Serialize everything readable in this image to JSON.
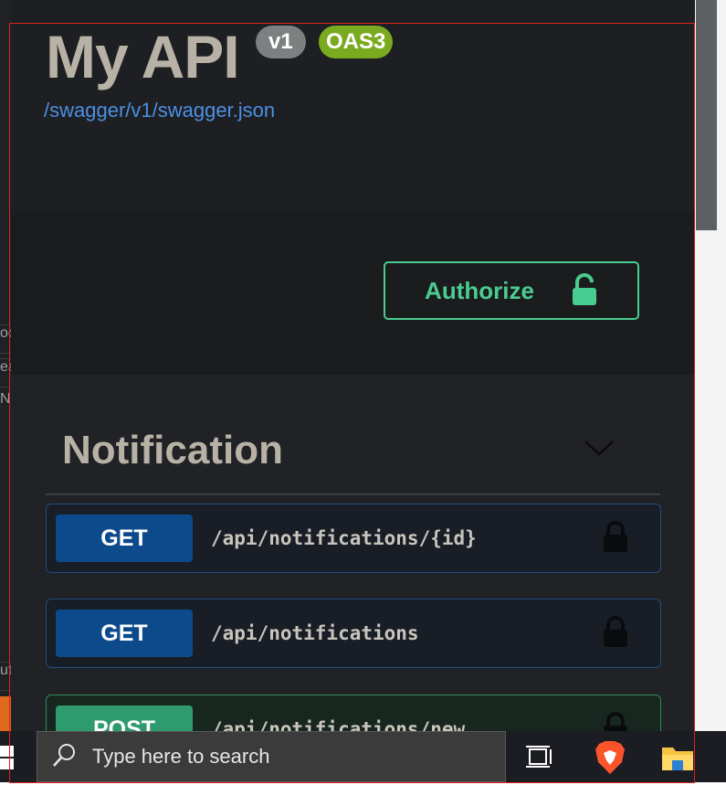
{
  "left_strip": {
    "fragments": [
      "oc",
      "ea",
      "N",
      "ut"
    ]
  },
  "api": {
    "title": "My API",
    "version": "v1",
    "oas": "OAS3",
    "spec_url": "/swagger/v1/swagger.json"
  },
  "authorize": {
    "label": "Authorize"
  },
  "tag": {
    "name": "Notification"
  },
  "operations": [
    {
      "method": "GET",
      "path": "/api/notifications/{id}"
    },
    {
      "method": "GET",
      "path": "/api/notifications"
    },
    {
      "method": "POST",
      "path": "/api/notifications/new"
    }
  ],
  "taskbar": {
    "search_placeholder": "Type here to search"
  },
  "colors": {
    "get": "#0c4a8c",
    "post": "#2f9a6d",
    "authorize": "#49cc90",
    "oas_badge": "#7aaa1f",
    "link": "#4a90e2"
  },
  "icons": [
    "unlocked-lock-icon",
    "lock-icon",
    "chevron-down-icon",
    "search-icon",
    "windows-icon",
    "task-view-icon",
    "brave-icon",
    "file-explorer-icon"
  ]
}
